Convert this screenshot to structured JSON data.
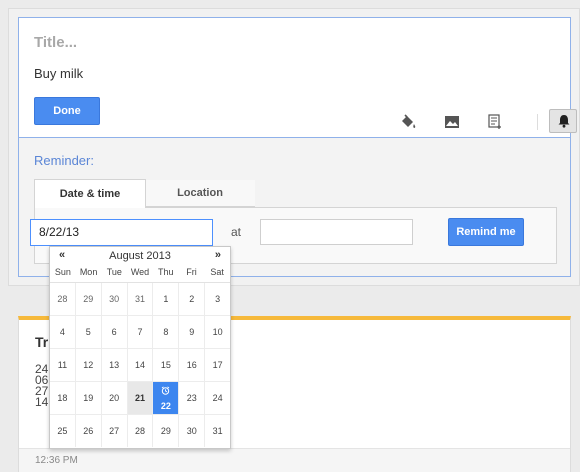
{
  "note": {
    "title_placeholder": "Title...",
    "body": "Buy milk",
    "done_label": "Done",
    "tools": [
      {
        "name": "paint-bucket-icon"
      },
      {
        "name": "image-icon"
      },
      {
        "name": "list-checkbox-icon"
      },
      {
        "name": "bell-icon"
      }
    ]
  },
  "reminder": {
    "label": "Reminder:",
    "tabs": [
      {
        "label": "Date & time"
      },
      {
        "label": "Location"
      }
    ],
    "date_value": "8/22/13",
    "at_label": "at",
    "time_value": "",
    "remind_label": "Remind me"
  },
  "datepicker": {
    "prev": "«",
    "next": "»",
    "month": "August 2013",
    "weekdays": [
      "Sun",
      "Mon",
      "Tue",
      "Wed",
      "Thu",
      "Fri",
      "Sat"
    ],
    "weeks": [
      [
        "28",
        "29",
        "30",
        "31",
        "1",
        "2",
        "3"
      ],
      [
        "4",
        "5",
        "6",
        "7",
        "8",
        "9",
        "10"
      ],
      [
        "11",
        "12",
        "13",
        "14",
        "15",
        "16",
        "17"
      ],
      [
        "18",
        "19",
        "20",
        "21",
        "22",
        "23",
        "24"
      ],
      [
        "25",
        "26",
        "27",
        "28",
        "29",
        "30",
        "31"
      ]
    ],
    "selected_day": "21",
    "today_day": "22"
  },
  "card2": {
    "title": "Tr",
    "lines": [
      "24",
      "06",
      "27",
      "14"
    ],
    "timestamp": "12:36 PM",
    "accent_color": "#f6b93b"
  },
  "colors": {
    "accent_blue": "#4a8cf0",
    "reminder_label": "#5b86d6"
  }
}
